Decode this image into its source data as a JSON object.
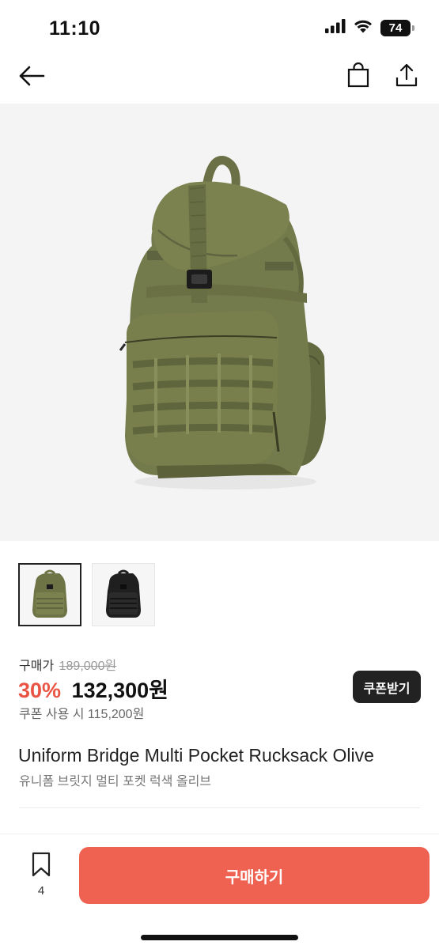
{
  "status_bar": {
    "time": "11:10",
    "battery": "74",
    "icons": [
      "cellular-signal-icon",
      "wifi-icon",
      "battery-icon"
    ]
  },
  "nav": {
    "icons": [
      "back-arrow-icon",
      "shopping-bag-icon",
      "share-icon"
    ]
  },
  "product": {
    "image_subject": "olive backpack",
    "thumbnails": [
      {
        "color": "#6f7446",
        "selected": true
      },
      {
        "color": "#1f1f1f",
        "selected": false
      }
    ],
    "price_label": "구매가",
    "original_price": "189,000원",
    "discount": "30%",
    "sale_price": "132,300원",
    "coupon_price": "쿠폰 사용 시 115,200원",
    "coupon_button": "쿠폰받기",
    "title_en": "Uniform Bridge Multi Pocket Rucksack Olive",
    "title_ko": "유니폼 브릿지 멀티 포켓 럭색 올리브"
  },
  "bottom_bar": {
    "wish_count": "4",
    "buy_button": "구매하기"
  },
  "colors": {
    "accent": "#ef6151",
    "discount": "#ea5444",
    "dark": "#222222",
    "olive": "#6f7446"
  }
}
